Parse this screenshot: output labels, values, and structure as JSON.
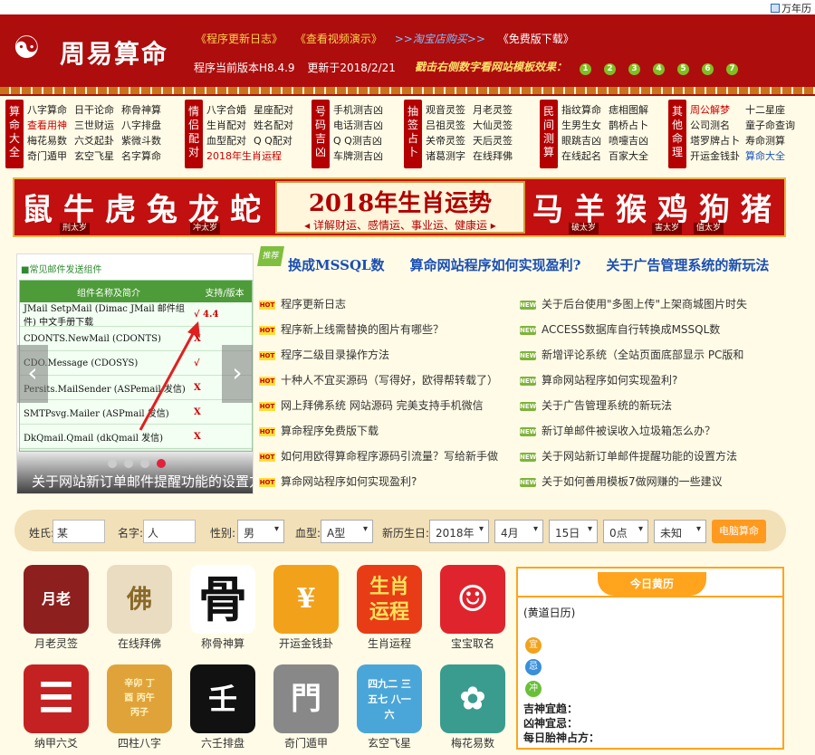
{
  "topbar": {
    "calendar_link": "万年历"
  },
  "header": {
    "logo_symbol": "☯",
    "logo_text": "周易算命",
    "links": [
      "《程序更新日志》",
      "《查看视频演示》",
      ">>淘宝店购买>>",
      "《免费版下载》"
    ],
    "version": "程序当前版本H8.4.9",
    "updated": "更新于2018/2/21",
    "model_prompt": "戳击右侧数字看网站模板效果：",
    "model_numbers": [
      "1",
      "2",
      "3",
      "4",
      "5",
      "6",
      "7"
    ]
  },
  "categories": [
    {
      "label": "算命大全",
      "items": [
        "八字算命",
        "日干论命",
        "称骨神算",
        "查看用神",
        "三世财运",
        "八字排盘",
        "梅花易数",
        "六爻起卦",
        "紫微斗数",
        "奇门遁甲",
        "玄空飞星",
        "名字算命"
      ]
    },
    {
      "label": "情侣配对",
      "items": [
        "八字合婚",
        "星座配对",
        "生肖配对",
        "姓名配对",
        "血型配对",
        "Q Q配对",
        "2018年生肖运程"
      ]
    },
    {
      "label": "号码吉凶",
      "items": [
        "手机测吉凶",
        "电话测吉凶",
        "Q Q测吉凶",
        "车牌测吉凶"
      ]
    },
    {
      "label": "抽签占卜",
      "items": [
        "观音灵签",
        "月老灵签",
        "吕祖灵签",
        "大仙灵签",
        "关帝灵签",
        "天后灵签",
        "诸葛测字",
        "在线拜佛"
      ]
    },
    {
      "label": "民间测算",
      "items": [
        "指纹算命",
        "痣相图解",
        "生男生女",
        "鹊桥占卜",
        "眼跳吉凶",
        "喷嚏吉凶",
        "在线起名",
        "百家大全"
      ]
    },
    {
      "label": "其他命理",
      "items": [
        "周公解梦",
        "十二星座",
        "公司测名",
        "童子命查询",
        "塔罗牌占卜",
        "寿命测算",
        "开运金钱卦",
        "算命大全"
      ]
    }
  ],
  "zodiac": {
    "left": [
      "鼠",
      "牛",
      "虎",
      "兔",
      "龙",
      "蛇"
    ],
    "right": [
      "马",
      "羊",
      "猴",
      "鸡",
      "狗",
      "猪"
    ],
    "tags": [
      "刑太岁",
      "冲太岁",
      "破太岁",
      "害太岁",
      "值太岁"
    ],
    "title": "2018年生肖运势",
    "subtitle": "◂ 详解财运、感情运、事业运、健康运 ▸"
  },
  "slider": {
    "header": "■常见邮件发送组件",
    "col1": "组件名称及简介",
    "col2": "支持/版本",
    "rows": [
      {
        "name": "JMail SetpMail (Dimac JMail 邮件组件)  中文手册下载",
        "mark": "√ 4.4"
      },
      {
        "name": "CDONTS.NewMail (CDONTS)",
        "mark": "X"
      },
      {
        "name": "CDO.Message (CDOSYS)",
        "mark": "√"
      },
      {
        "name": "Persits.MailSender (ASPemail 发信)",
        "mark": "X"
      },
      {
        "name": "SMTPsvg.Mailer (ASPmail 发信)",
        "mark": "X"
      },
      {
        "name": "DkQmail.Qmail (dkQmail 发信)",
        "mark": "X"
      }
    ],
    "caption": "关于网站新订单邮件提醒功能的设置方法",
    "prev": "‹",
    "next": "›"
  },
  "headlines": {
    "badge": "推荐",
    "items": [
      "换成MSSQL数",
      "算命网站程序如何实现盈利?",
      "关于广告管理系统的新玩法"
    ]
  },
  "news_left": {
    "badge": "HOT",
    "items": [
      "程序更新日志",
      "程序新上线需替换的图片有哪些？",
      "程序二级目录操作方法",
      "十种人不宜买源码（写得好，欧得帮转载了）",
      "网上拜佛系统 网站源码 完美支持手机微信",
      "算命程序免费版下载",
      "如何用欧得算命程序源码引流量？写给新手做",
      "算命网站程序如何实现盈利?"
    ]
  },
  "news_right": {
    "badge": "NEW",
    "items": [
      "关于后台使用\"多图上传\"上架商城图片时失",
      "ACCESS数据库自行转换成MSSQL数",
      "新增评论系统（全站页面底部显示 PC版和",
      "算命网站程序如何实现盈利?",
      "关于广告管理系统的新玩法",
      "新订单邮件被误收入垃圾箱怎么办？",
      "关于网站新订单邮件提醒功能的设置方法",
      "关于如何善用模板7做网赚的一些建议"
    ]
  },
  "search": {
    "surname_label": "姓氏:",
    "surname_value": "某",
    "name_label": "名字:",
    "name_value": "人",
    "gender_label": "性别:",
    "gender_value": "男",
    "blood_label": "血型:",
    "blood_value": "A型",
    "date_label": "新历生日:",
    "year_value": "2018年",
    "month_value": "4月",
    "day_value": "15日",
    "hour_value": "0点",
    "unknown_value": "未知",
    "button": "电脑算命"
  },
  "apps": [
    {
      "name": "月老灵签",
      "glyph": "月老",
      "color": "#8d1f1f"
    },
    {
      "name": "在线拜佛",
      "glyph": "佛",
      "color": "#d8c49a"
    },
    {
      "name": "称骨神算",
      "glyph": "骨",
      "color": "#ffffff"
    },
    {
      "name": "开运金钱卦",
      "glyph": "¥",
      "color": "#f2a21a"
    },
    {
      "name": "生肖运程",
      "glyph": "生肖运程",
      "color": "#e83c16"
    },
    {
      "name": "宝宝取名",
      "glyph": "☺",
      "color": "#e0242d"
    },
    {
      "name": "纳甲六爻",
      "glyph": "☰",
      "color": "#c42222"
    },
    {
      "name": "四柱八字",
      "glyph": "辛卯 丁酉 丙午 丙子",
      "color": "#e0a33a"
    },
    {
      "name": "六壬排盘",
      "glyph": "壬",
      "color": "#111111"
    },
    {
      "name": "奇门遁甲",
      "glyph": "門",
      "color": "#888888"
    },
    {
      "name": "玄空飞星",
      "glyph": "四九二 三五七 八一六",
      "color": "#4aa6d8"
    },
    {
      "name": "梅花易数",
      "glyph": "✿",
      "color": "#3a9c8e"
    }
  ],
  "calendar": {
    "title": "今日黄历",
    "lunar": "(黄道日历)",
    "icons": [
      "宜",
      "忌",
      "冲"
    ],
    "god_label": "吉神宜趋：",
    "evil_label": "凶神宜忌：",
    "fetal_label": "每日胎神占方："
  }
}
